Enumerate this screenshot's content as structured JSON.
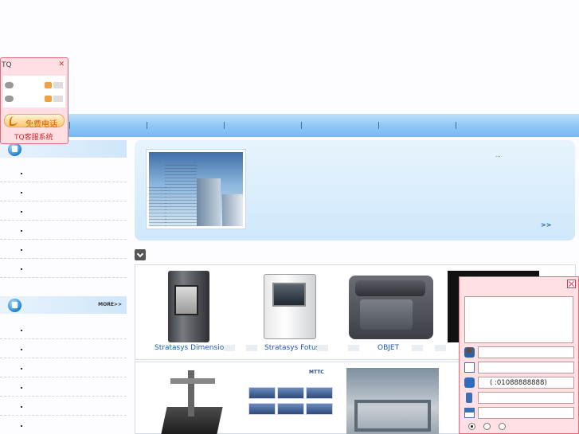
{
  "tq": {
    "title": "TQ",
    "close": "✕",
    "call_label": "免费电话",
    "footer": "TQ客服系统"
  },
  "sidebar": {
    "more_label": "MORE>>"
  },
  "banner": {
    "ellipsis": "...",
    "more": ">>"
  },
  "products": {
    "row1": [
      {
        "name": "Stratasys  Dimension"
      },
      {
        "name": "Stratasys  Fotus"
      },
      {
        "name": "OBJET"
      }
    ],
    "parts_logo": "MTTC"
  },
  "message_form": {
    "phone_value": "( :01088888888)"
  },
  "colors": {
    "nav": "#8cc6f5",
    "tq_border": "#e36a78",
    "link": "#1a5aa8"
  }
}
